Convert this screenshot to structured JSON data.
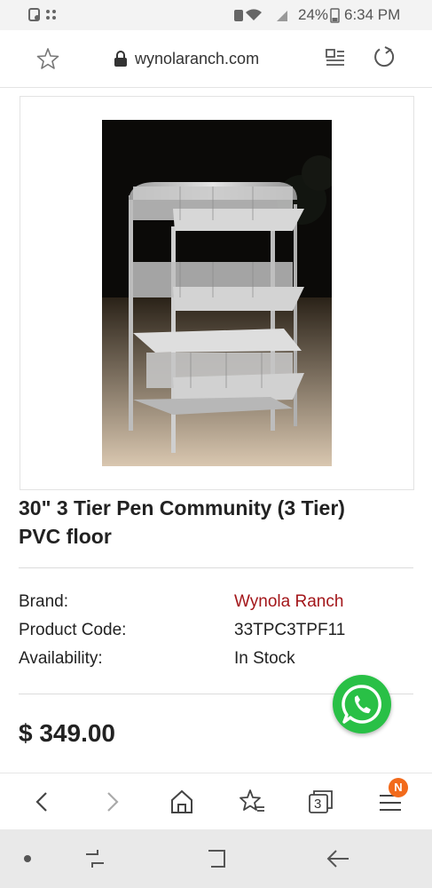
{
  "status_bar": {
    "battery": "24%",
    "time": "6:34 PM"
  },
  "url_bar": {
    "domain": "wynolaranch.com",
    "icons": [
      "star-icon",
      "lock-icon",
      "reader-mode-icon",
      "refresh-icon"
    ]
  },
  "product": {
    "title_line1": "30\" 3 Tier Pen Community (3 Tier)",
    "title_line2": "PVC floor",
    "specs": [
      {
        "label": "Brand:",
        "value": "Wynola Ranch"
      },
      {
        "label": "Product Code:",
        "value": "33TPC3TPF11"
      },
      {
        "label": "Availability:",
        "value": "In Stock"
      }
    ],
    "price": "$ 349.00"
  },
  "toolbar": {
    "icons": [
      "back-icon",
      "forward-icon",
      "home-icon",
      "bookmarks-icon",
      "tabs-icon",
      "menu-icon"
    ],
    "tab_count": "3",
    "menu_badge": "N"
  },
  "colors": {
    "brand_link": "#a3161a",
    "whatsapp": "#29c046",
    "badge": "#f26a1b"
  }
}
